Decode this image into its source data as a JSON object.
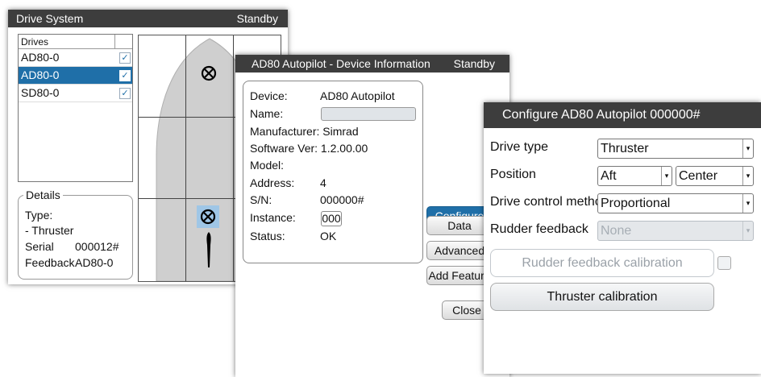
{
  "drive_system": {
    "title": "Drive System",
    "status": "Standby",
    "drives_header": "Drives",
    "drives": [
      {
        "name": "AD80-0",
        "checked": true,
        "selected": false
      },
      {
        "name": "AD80-0",
        "checked": true,
        "selected": true
      },
      {
        "name": "SD80-0",
        "checked": true,
        "selected": false
      }
    ],
    "details": {
      "legend": "Details",
      "type_label": "Type:",
      "type_value": "- Thruster",
      "serial_label": "Serial",
      "serial_value": "000012#",
      "feedback_label": "Feedback",
      "feedback_value": "AD80-0"
    }
  },
  "device_info": {
    "title": "AD80 Autopilot - Device Information",
    "status": "Standby",
    "labels": {
      "device": "Device:",
      "name": "Name:",
      "manufacturer": "Manufacturer: Simrad",
      "software": "Software Ver: 1.2.00.00",
      "model": "Model:",
      "address": "Address:",
      "sn": "S/N:",
      "instance": "Instance:",
      "status": "Status:"
    },
    "values": {
      "device": "AD80 Autopilot",
      "address": "4",
      "sn": "000000#",
      "instance": "000",
      "status": "OK"
    },
    "buttons": {
      "configure": "Configure",
      "data": "Data",
      "advanced": "Advanced",
      "add_feature": "Add Feature",
      "close": "Close"
    }
  },
  "configure": {
    "title": "Configure AD80 Autopilot 000000#",
    "drive_type_label": "Drive type",
    "drive_type_value": "Thruster",
    "position_label": "Position",
    "position_value_1": "Aft",
    "position_value_2": "Center",
    "control_method_label": "Drive control method",
    "control_method_value": "Proportional",
    "rudder_feedback_label": "Rudder feedback",
    "rudder_feedback_value": "None",
    "rudder_calibration_button": "Rudder feedback calibration",
    "thruster_calibration_button": "Thruster calibration"
  },
  "icons": {
    "dropdown_arrow": "▾",
    "check": "✓"
  },
  "colors": {
    "titlebar": "#3d3d3d",
    "accent": "#1f6fa8",
    "hull": "#cfcfcf"
  }
}
